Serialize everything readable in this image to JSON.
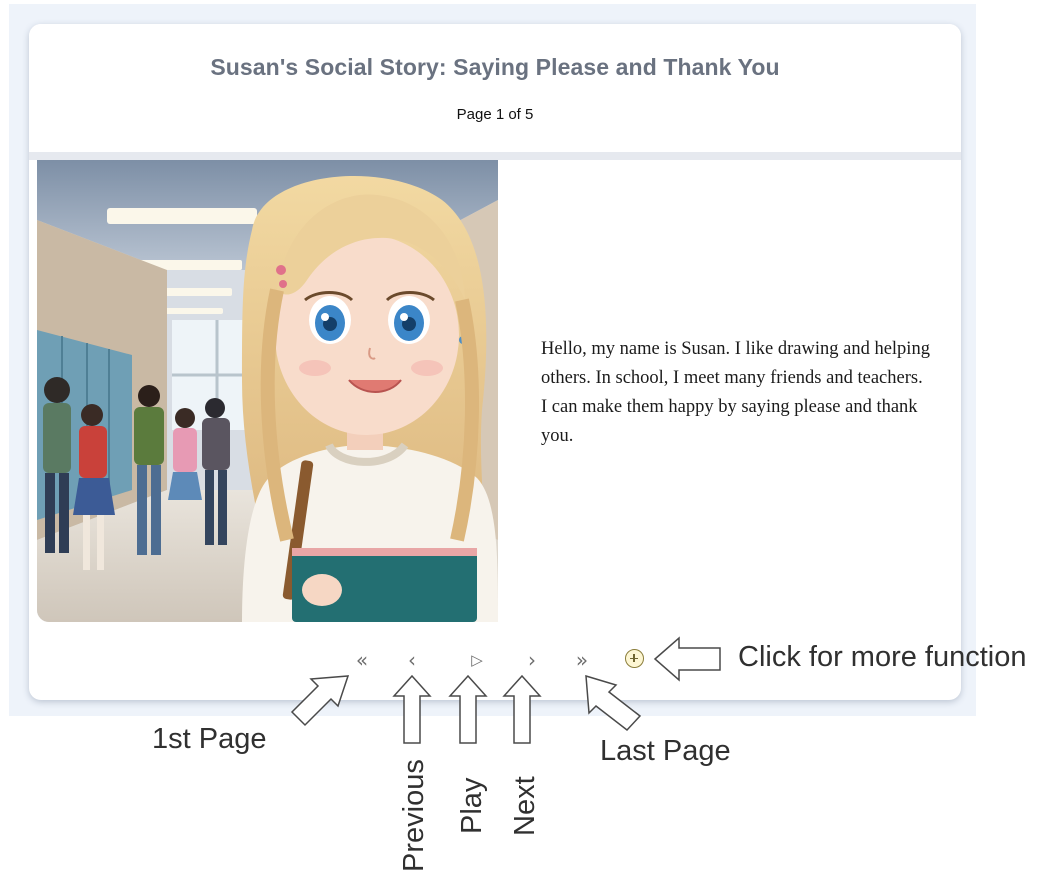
{
  "story": {
    "title": "Susan's Social Story: Saying Please and Thank You",
    "page_indicator": "Page 1 of 5",
    "text": "Hello, my name is Susan. I like drawing and helping others. In school, I meet many friends and teachers. I can make them happy by saying please and thank you."
  },
  "controls": {
    "first_glyph": "«",
    "previous_glyph": "‹",
    "play_glyph": "▷",
    "next_glyph": "›",
    "last_glyph": "»",
    "more_icon": "plus-circle-icon"
  },
  "annotations": {
    "more": "Click for more function",
    "first": "1st Page",
    "last": "Last Page",
    "previous": "Previous",
    "play": "Play",
    "next": "Next"
  },
  "colors": {
    "title": "#6a7280",
    "control": "#6e6e6e",
    "annotation": "#303030",
    "backdrop": "#eef3fa"
  }
}
